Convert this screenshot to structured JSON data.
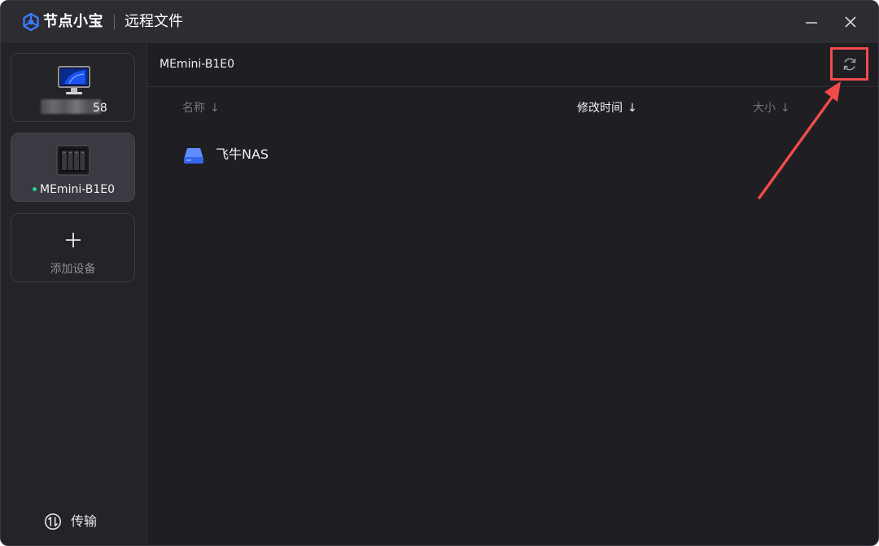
{
  "app": {
    "name": "节点小宝",
    "window_title": "远程文件",
    "logo_icon": "node-logo-icon",
    "accent_color": "#3d7bff"
  },
  "window_controls": {
    "minimize_icon": "minimize-icon",
    "close_icon": "close-icon"
  },
  "sidebar": {
    "devices": [
      {
        "name": "58",
        "icon": "pc-monitor-icon",
        "name_partially_redacted": true,
        "selected": false
      },
      {
        "name": "MEmini-B1E0",
        "icon": "nas-icon",
        "online": true,
        "status_color": "#2fd08a",
        "selected": true
      }
    ],
    "add_device": {
      "label": "添加设备",
      "icon": "plus-icon"
    },
    "transfer": {
      "label": "传输",
      "icon": "transfer-icon"
    }
  },
  "main": {
    "path_title": "MEmini-B1E0",
    "refresh_icon": "refresh-icon",
    "columns": [
      {
        "label": "名称",
        "sort_arrow": "↓",
        "active": false
      },
      {
        "label": "修改时间",
        "sort_arrow": "↓",
        "active": true
      },
      {
        "label": "大小",
        "sort_arrow": "↓",
        "active": false
      }
    ],
    "files": [
      {
        "name": "飞牛NAS",
        "icon": "drive-icon",
        "modified": "",
        "size": ""
      }
    ]
  },
  "annotation": {
    "highlight_color": "#f24b4b",
    "target": "refresh-button"
  }
}
